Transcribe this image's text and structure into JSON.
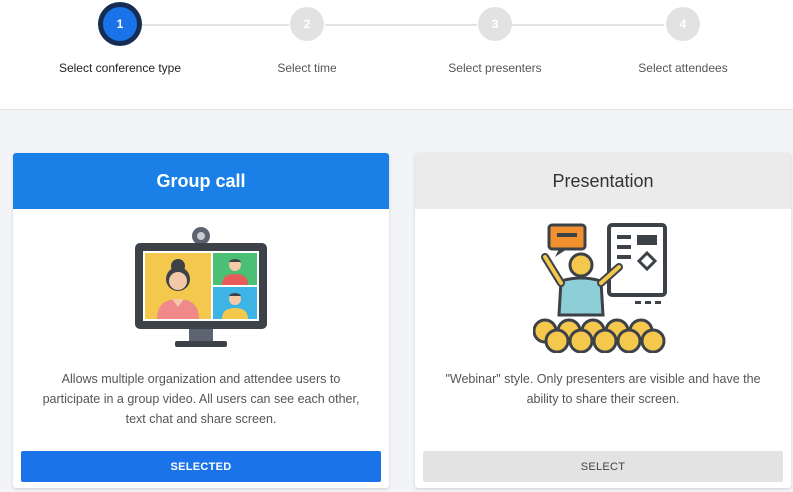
{
  "colors": {
    "accent": "#1a73e8",
    "inactive": "#e2e2e2",
    "header_selected": "#1a80e8",
    "header_unselected": "#ebebeb"
  },
  "stepper": {
    "steps": [
      {
        "number": "1",
        "label": "Select conference type",
        "active": true
      },
      {
        "number": "2",
        "label": "Select time",
        "active": false
      },
      {
        "number": "3",
        "label": "Select presenters",
        "active": false
      },
      {
        "number": "4",
        "label": "Select attendees",
        "active": false
      }
    ]
  },
  "options": [
    {
      "title": "Group call",
      "icon": "video-conference-icon",
      "description": "Allows multiple organization and attendee users to participate in a group video. All users can see each other, text chat and share screen.",
      "button_label": "SELECTED",
      "selected": true
    },
    {
      "title": "Presentation",
      "icon": "presenter-icon",
      "description": "\"Webinar\" style. Only presenters are visible and have the ability to share their screen.",
      "button_label": "SELECT",
      "selected": false
    }
  ]
}
